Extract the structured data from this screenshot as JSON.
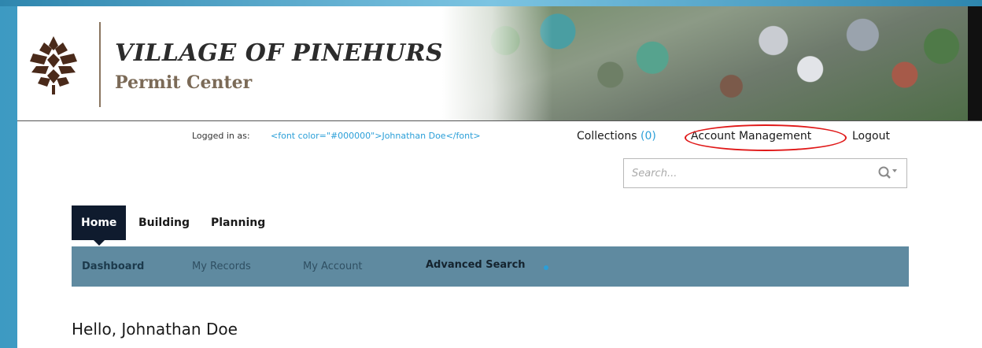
{
  "header": {
    "title": "VILLAGE OF PINEHURST",
    "subtitle": "Permit Center"
  },
  "user_bar": {
    "logged_in_label": "Logged in as:",
    "logged_in_user": "<font color=\"#000000\">Johnathan Doe</font>",
    "collections_label": "Collections",
    "collections_count": "(0)",
    "account_management": "Account Management",
    "logout": "Logout"
  },
  "search": {
    "placeholder": "Search..."
  },
  "nav": {
    "tabs": [
      {
        "label": "Home",
        "active": true
      },
      {
        "label": "Building",
        "active": false
      },
      {
        "label": "Planning",
        "active": false
      }
    ]
  },
  "subnav": {
    "items": [
      {
        "label": "Dashboard",
        "active": true
      },
      {
        "label": "My Records",
        "active": false
      },
      {
        "label": "My Account",
        "active": false
      },
      {
        "label": "Advanced Search",
        "active": false
      }
    ]
  },
  "greeting": "Hello, Johnathan Doe",
  "colors": {
    "brand_dark": "#0f1b2e",
    "subnav_bg": "#5f8aa0",
    "link_blue": "#2b9fd8",
    "highlight": "#e01818"
  }
}
